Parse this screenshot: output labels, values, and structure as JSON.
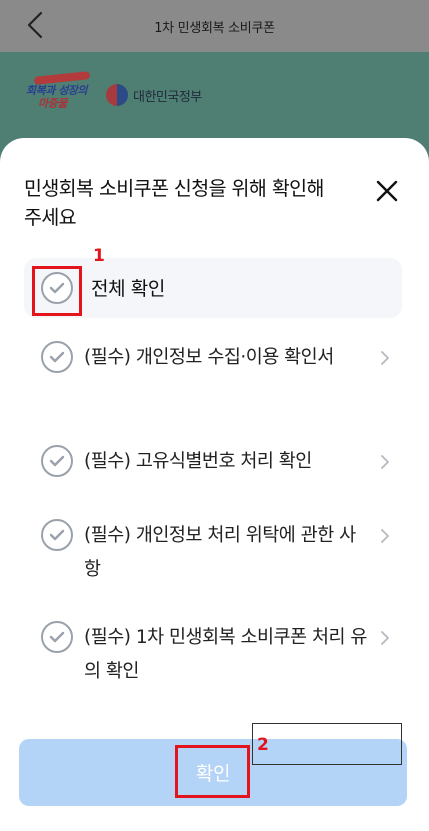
{
  "header": {
    "title": "1차 민생회복 소비쿠폰"
  },
  "banner": {
    "promo_line1": "회복과 성장의",
    "promo_line2": "마중물",
    "gov_name": "대한민국정부"
  },
  "sheet": {
    "title": "민생회복 소비쿠폰 신청을 위해 확인해 주세요",
    "all_label": "전체 확인",
    "items": [
      {
        "label": "(필수) 개인정보 수집·이용 확인서"
      },
      {
        "label": "(필수) 고유식별번호 처리 확인"
      },
      {
        "label": "(필수) 개인정보 처리 위탁에 관한 사항"
      },
      {
        "label": "(필수) 1차 민생회복 소비쿠폰 처리 유의 확인"
      }
    ],
    "confirm_label": "확인"
  },
  "annotations": {
    "num1": "1",
    "num2": "2"
  },
  "colors": {
    "accent_red": "#e3141b",
    "button_bg": "#b3d3f7",
    "check_gray": "#9aa1ab"
  },
  "icons": [
    "back-arrow-icon",
    "close-icon",
    "check-icon",
    "chevron-right-icon"
  ]
}
